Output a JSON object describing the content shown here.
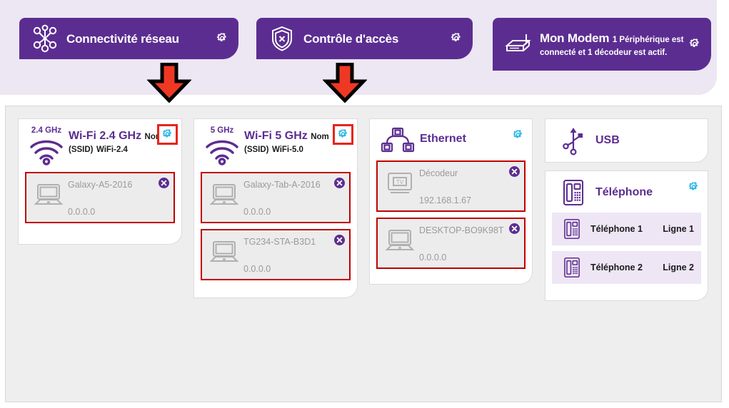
{
  "colors": {
    "purple": "#5c2d91",
    "header_band": "#ece7f2",
    "panel_bg": "#eeeeee",
    "gear_cyan": "#29b6e8",
    "highlight_red": "#e8241c",
    "row_border_red": "#c00000",
    "row_bg": "#ececec",
    "phone_row_bg": "#eee6f5",
    "arrow_red": "#ee3824"
  },
  "header": {
    "buttons": [
      {
        "id": "connectivity",
        "title": "Connectivité réseau",
        "subtitle": "",
        "icon": "network-nodes-icon",
        "gear": "gear-icon"
      },
      {
        "id": "access-control",
        "title": "Contrôle d'accès",
        "subtitle": "",
        "icon": "shield-x-icon",
        "gear": "gear-icon"
      },
      {
        "id": "my-modem",
        "title": "Mon Modem",
        "subtitle": "1 Périphérique est connecté et 1 décodeur est actif.",
        "icon": "modem-icon",
        "gear": "gear-icon"
      }
    ]
  },
  "annotations": {
    "arrows": [
      {
        "name": "arrow-to-connectivity",
        "direction": "down"
      },
      {
        "name": "arrow-to-access-control",
        "direction": "down"
      }
    ]
  },
  "cards": {
    "wifi24": {
      "band": "2.4 GHz",
      "title": "Wi-Fi 2.4 GHz",
      "ssid_label": "Nom (SSID)",
      "ssid_value": "WiFi-2.4",
      "icon": "wifi-icon",
      "gear": "gear-icon",
      "gear_highlighted": true,
      "devices": [
        {
          "name": "Galaxy-A5-2016",
          "ip": "0.0.0.0",
          "icon": "laptop-icon",
          "close": "close-icon"
        }
      ]
    },
    "wifi5": {
      "band": "5 GHz",
      "title": "Wi-Fi 5 GHz",
      "ssid_label": "Nom (SSID)",
      "ssid_value": "WiFi-5.0",
      "icon": "wifi-icon",
      "gear": "gear-icon",
      "gear_highlighted": true,
      "devices": [
        {
          "name": "Galaxy-Tab-A-2016",
          "ip": "0.0.0.0",
          "icon": "laptop-icon",
          "close": "close-icon"
        },
        {
          "name": "TG234-STA-B3D1",
          "ip": "0.0.0.0",
          "icon": "laptop-icon",
          "close": "close-icon"
        }
      ]
    },
    "ethernet": {
      "title": "Ethernet",
      "icon": "ethernet-icon",
      "gear": "gear-icon",
      "gear_highlighted": false,
      "devices": [
        {
          "name": "Décodeur",
          "ip": "192.168.1.67",
          "icon": "tv-icon",
          "close": "close-icon"
        },
        {
          "name": "DESKTOP-BO9K98T",
          "ip": "0.0.0.0",
          "icon": "laptop-icon",
          "close": "close-icon"
        }
      ]
    },
    "usb": {
      "title": "USB",
      "icon": "usb-icon"
    },
    "phone": {
      "title": "Téléphone",
      "icon": "desk-phone-icon",
      "gear": "gear-icon",
      "lines": [
        {
          "name": "Téléphone 1",
          "line": "Ligne 1",
          "icon": "desk-phone-icon"
        },
        {
          "name": "Téléphone 2",
          "line": "Ligne 2",
          "icon": "desk-phone-icon"
        }
      ]
    }
  }
}
